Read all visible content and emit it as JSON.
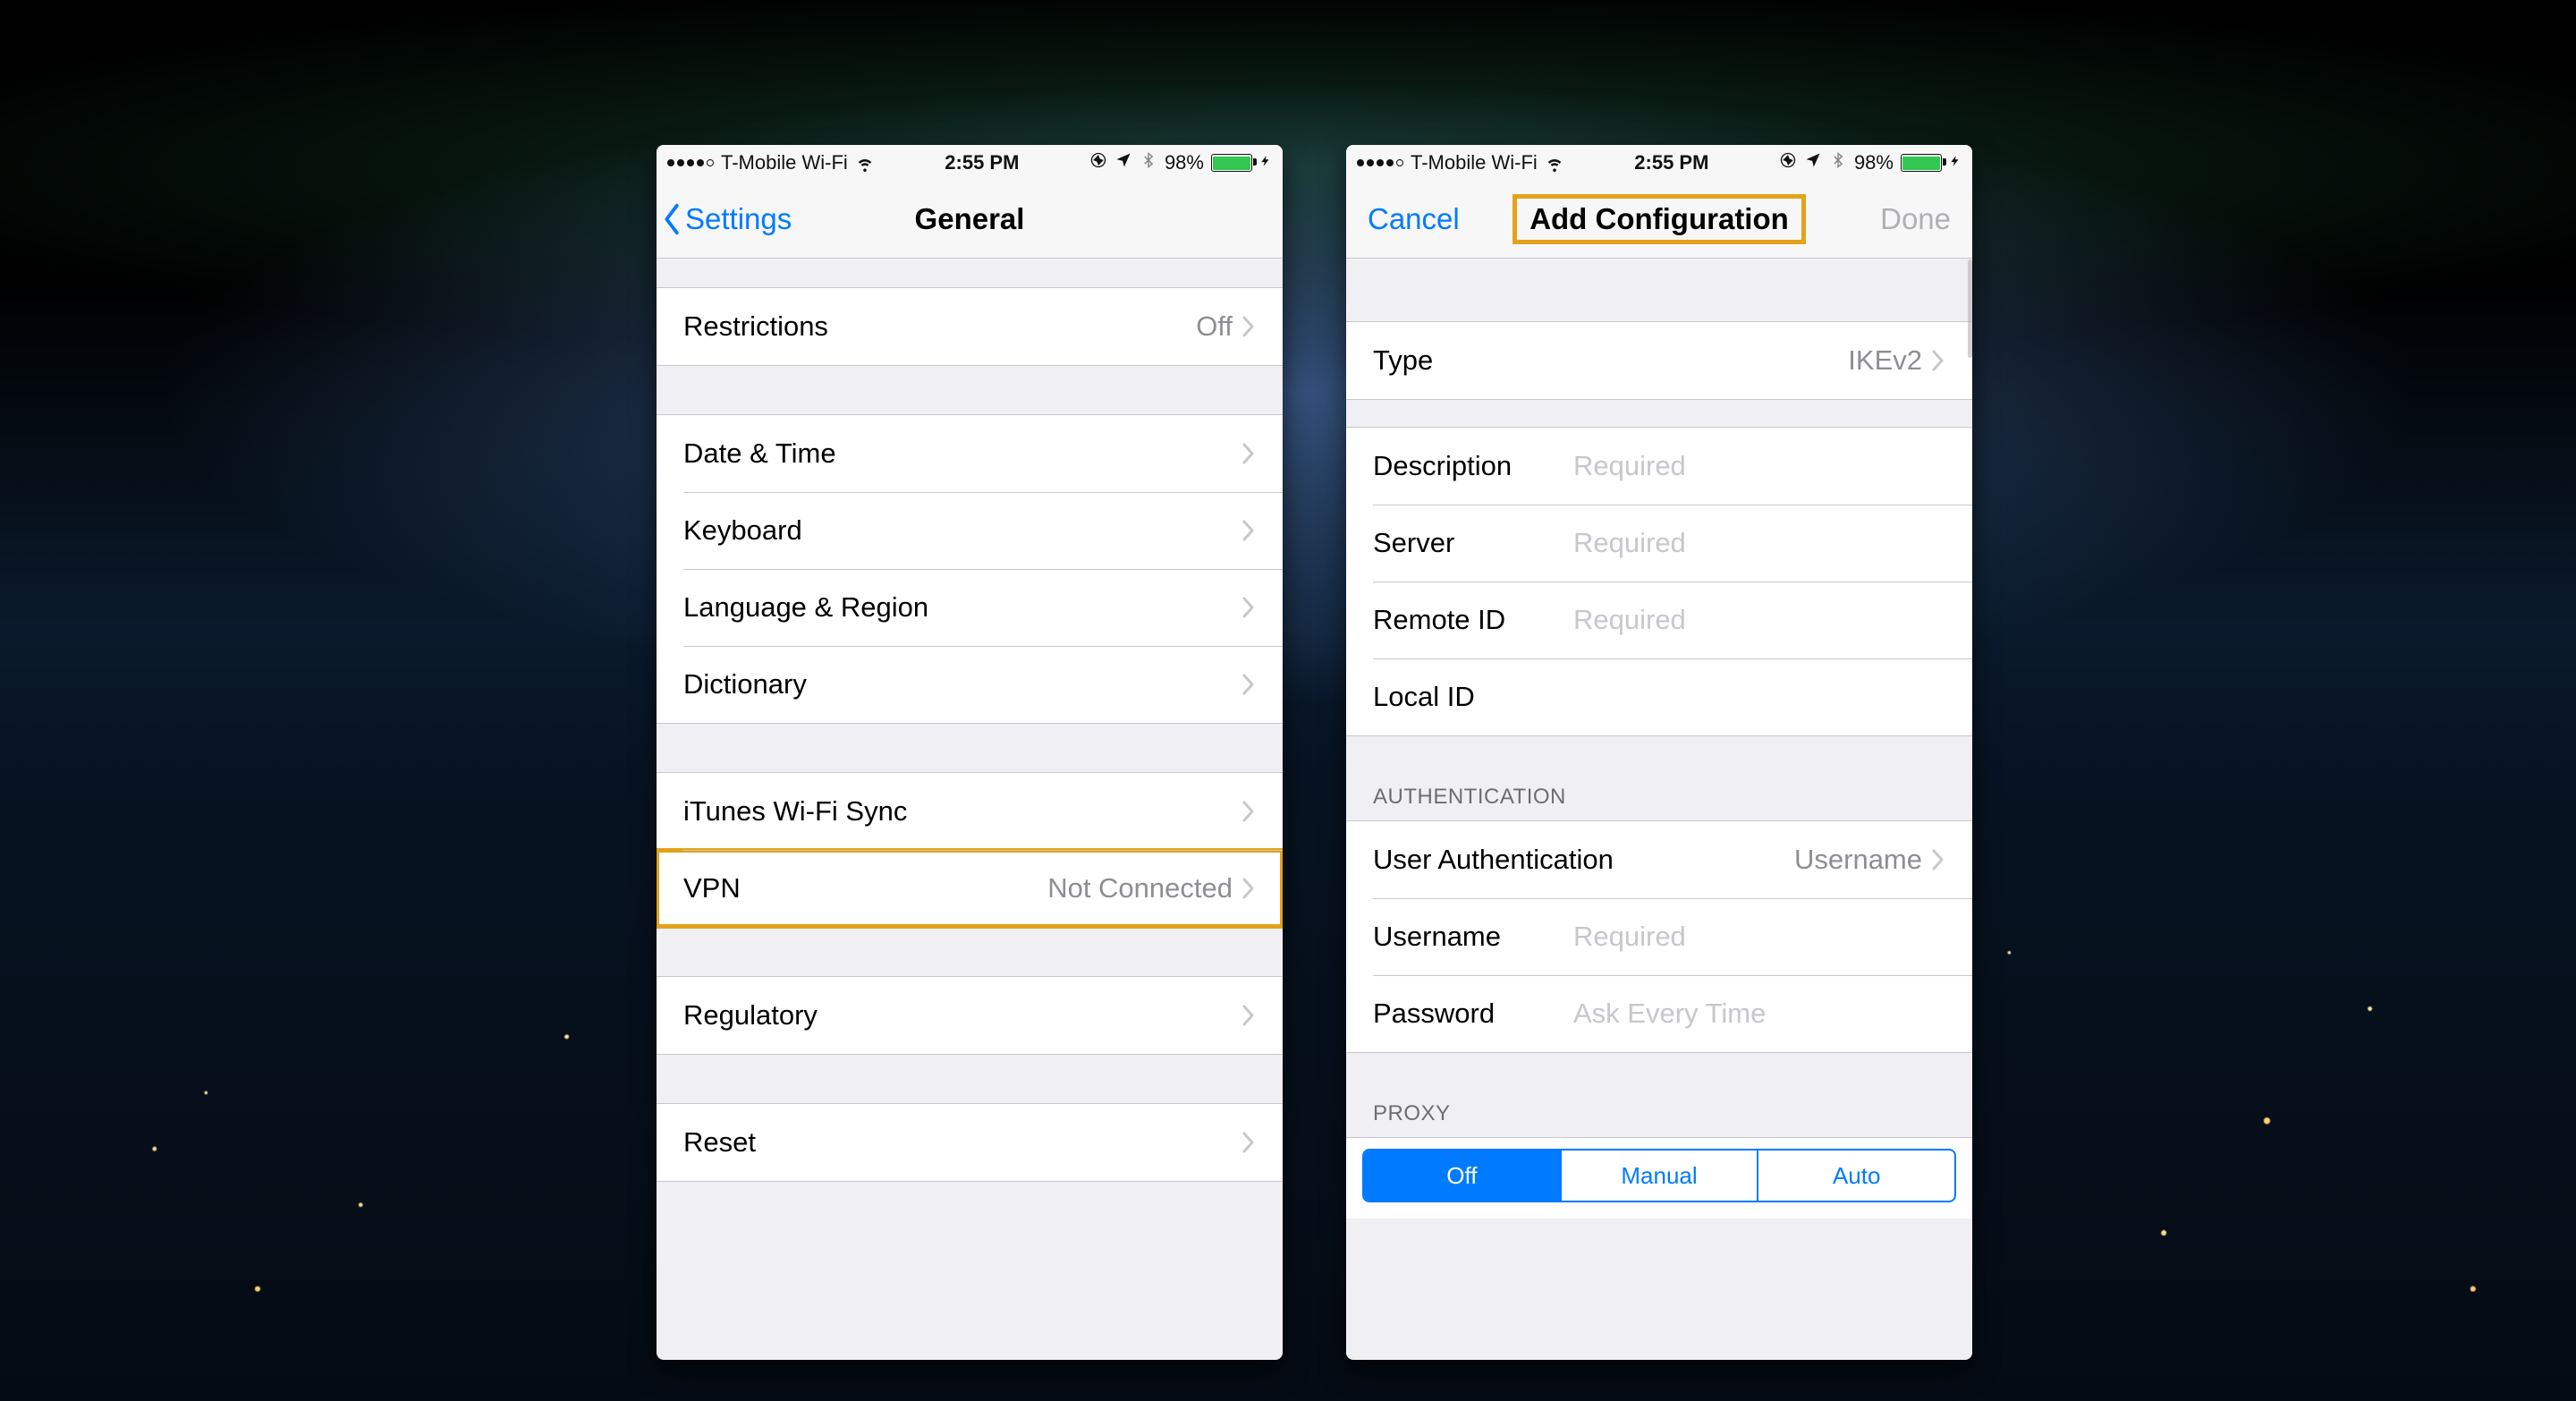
{
  "status": {
    "carrier": "T-Mobile Wi-Fi",
    "time": "2:55 PM",
    "battery_pct": "98%"
  },
  "left": {
    "nav_back": "Settings",
    "nav_title": "General",
    "rows": {
      "restrictions": "Restrictions",
      "restrictions_val": "Off",
      "date_time": "Date & Time",
      "keyboard": "Keyboard",
      "language_region": "Language & Region",
      "dictionary": "Dictionary",
      "itunes_wifi": "iTunes Wi-Fi Sync",
      "vpn": "VPN",
      "vpn_val": "Not Connected",
      "regulatory": "Regulatory",
      "reset": "Reset"
    }
  },
  "right": {
    "nav_cancel": "Cancel",
    "nav_title": "Add Configuration",
    "nav_done": "Done",
    "type_label": "Type",
    "type_value": "IKEv2",
    "fields": {
      "description": "Description",
      "server": "Server",
      "remote_id": "Remote ID",
      "local_id": "Local ID",
      "placeholder_required": "Required"
    },
    "auth_header": "AUTHENTICATION",
    "auth": {
      "user_auth": "User Authentication",
      "user_auth_val": "Username",
      "username": "Username",
      "password": "Password",
      "password_placeholder": "Ask Every Time"
    },
    "proxy_header": "PROXY",
    "proxy_segments": {
      "off": "Off",
      "manual": "Manual",
      "auto": "Auto"
    }
  }
}
